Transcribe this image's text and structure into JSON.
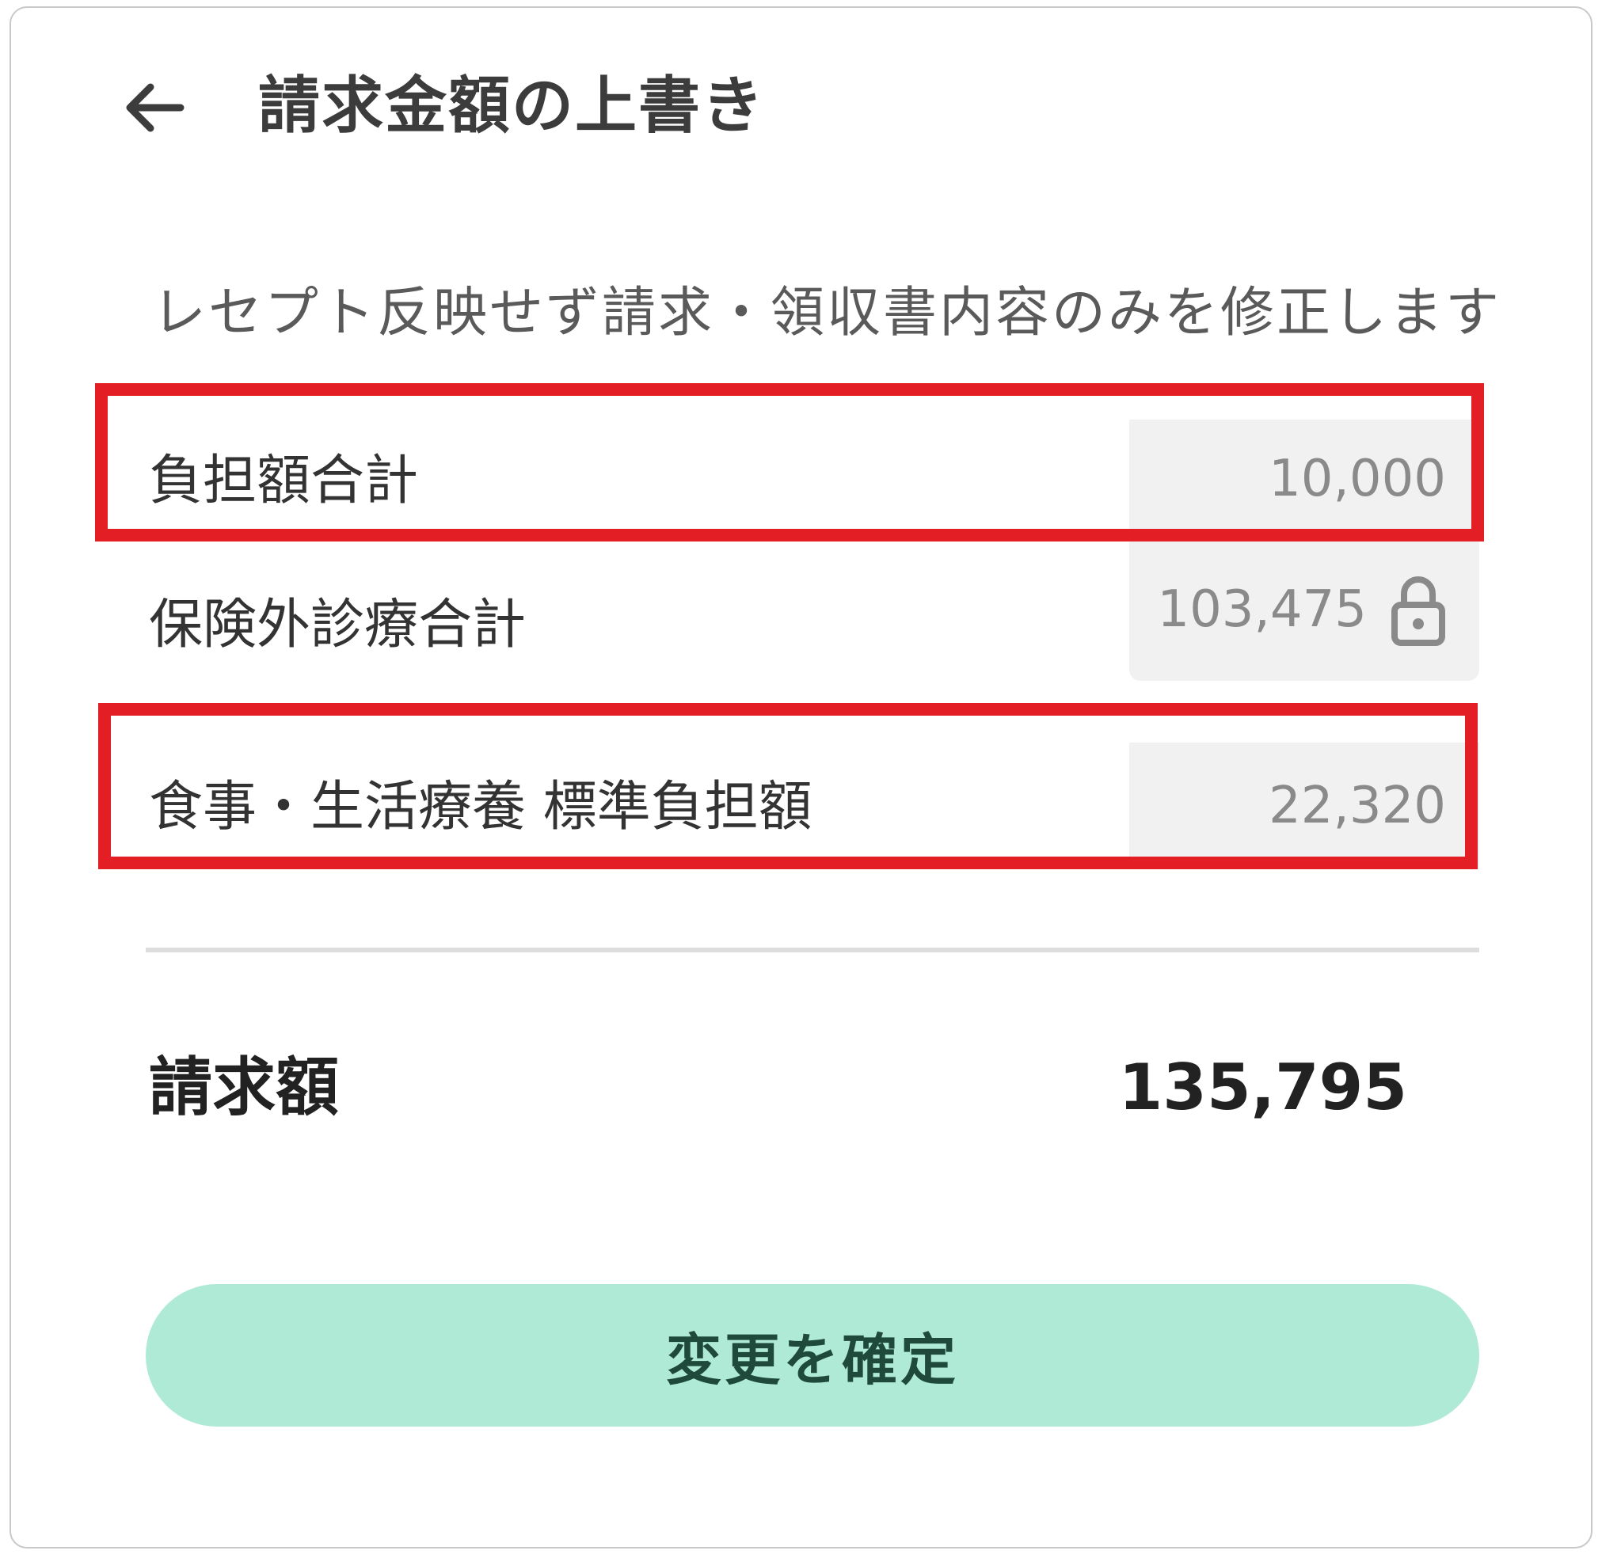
{
  "header": {
    "title": "請求金額の上書き",
    "back_icon": "arrow-left-icon"
  },
  "description": "レセプト反映せず請求・領収書内容のみを修正します",
  "fields": [
    {
      "label": "負担額合計",
      "value": "10,000",
      "locked": false,
      "highlighted": true
    },
    {
      "label": "保険外診療合計",
      "value": "103,475",
      "locked": true,
      "highlighted": false
    },
    {
      "label": "食事・生活療養 標準負担額",
      "value": "22,320",
      "locked": false,
      "highlighted": true
    }
  ],
  "total": {
    "label": "請求額",
    "value": "135,795"
  },
  "confirm_button": {
    "label": "変更を確定"
  },
  "colors": {
    "highlight": "#e41e25",
    "button_bg": "#aeead5",
    "input_bg": "#f1f1f1"
  }
}
